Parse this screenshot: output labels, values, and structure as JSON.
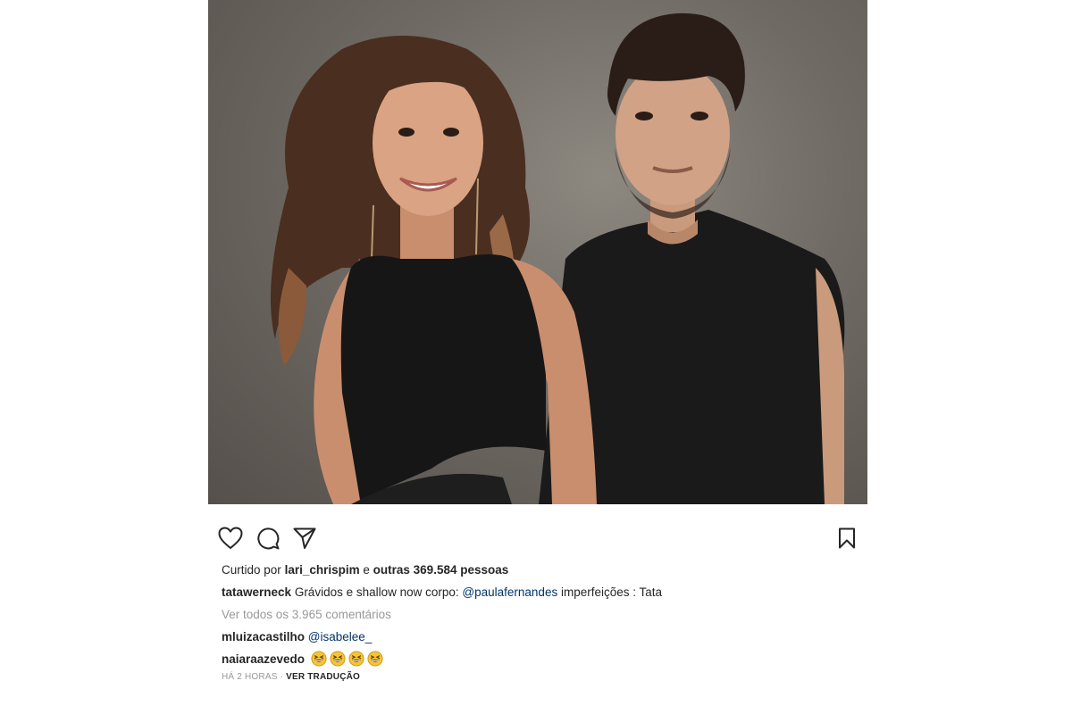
{
  "post": {
    "photo_alt": "",
    "likes": {
      "prefix": "Curtido por",
      "user": "lari_chrispim",
      "connector": "e",
      "others": "outras 369.584 pessoas"
    },
    "caption": {
      "user": "tatawerneck",
      "text_before": "Grávidos e shallow now corpo:",
      "mention": "@paulafernandes",
      "text_after": "imperfeições : Tata"
    },
    "view_comments": "Ver todos os 3.965 comentários",
    "comments": [
      {
        "user": "mluizacastilho",
        "mention": "@isabelee_"
      },
      {
        "user": "naiaraazevedo",
        "emoji_count": 4,
        "emoji": "grinning-squinting-face"
      }
    ],
    "time": "HÁ 2 HORAS",
    "separator": "·",
    "translate": "VER TRADUÇÃO"
  },
  "icons": {
    "like": "heart-icon",
    "comment": "comment-bubble-icon",
    "share": "paper-plane-icon",
    "save": "bookmark-icon"
  },
  "colors": {
    "text": "#262626",
    "mention": "#003569",
    "muted": "#999999",
    "background": "#ffffff"
  }
}
